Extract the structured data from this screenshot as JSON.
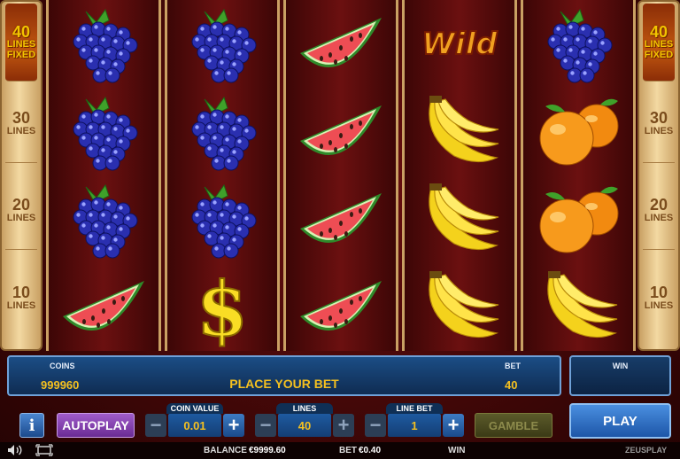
{
  "lines_indicator": {
    "left": [
      {
        "n": "40",
        "t": "LINES",
        "t2": "FIXED",
        "active": true
      },
      {
        "n": "30",
        "t": "LINES",
        "active": false
      },
      {
        "n": "20",
        "t": "LINES",
        "active": false
      },
      {
        "n": "10",
        "t": "LINES",
        "active": false
      }
    ],
    "right": [
      {
        "n": "40",
        "t": "LINES",
        "t2": "FIXED",
        "active": true
      },
      {
        "n": "30",
        "t": "LINES",
        "active": false
      },
      {
        "n": "20",
        "t": "LINES",
        "active": false
      },
      {
        "n": "10",
        "t": "LINES",
        "active": false
      }
    ]
  },
  "reels": [
    [
      "grapes",
      "grapes",
      "grapes",
      "watermelon"
    ],
    [
      "grapes",
      "grapes",
      "grapes",
      "dollar"
    ],
    [
      "watermelon",
      "watermelon",
      "watermelon",
      "watermelon"
    ],
    [
      "wild",
      "banana",
      "banana",
      "banana"
    ],
    [
      "grapes",
      "orange",
      "orange",
      "banana"
    ]
  ],
  "wild_text": "Wild",
  "info": {
    "coins_label": "COINS",
    "coins_value": "999960",
    "message": "PLACE YOUR BET",
    "bet_label": "BET",
    "bet_value": "40",
    "win_label": "WIN"
  },
  "controls": {
    "info_label": "i",
    "autoplay_label": "AUTOPLAY",
    "coin_value_label": "COIN VALUE",
    "coin_value": "0.01",
    "lines_label": "LINES",
    "lines_value": "40",
    "line_bet_label": "LINE BET",
    "line_bet_value": "1",
    "gamble_label": "GAMBLE",
    "play_label": "PLAY",
    "minus": "−",
    "plus": "+"
  },
  "footer": {
    "balance_label": "BALANCE",
    "balance_value": "€9999.60",
    "bet_label": "BET",
    "bet_value": "€0.40",
    "win_label": "WIN",
    "brand": "ZEUSPLAY"
  },
  "colors": {
    "accent_gold": "#f4c020",
    "panel_blue": "#1b4d85",
    "autoplay_purple": "#6a2b94"
  }
}
